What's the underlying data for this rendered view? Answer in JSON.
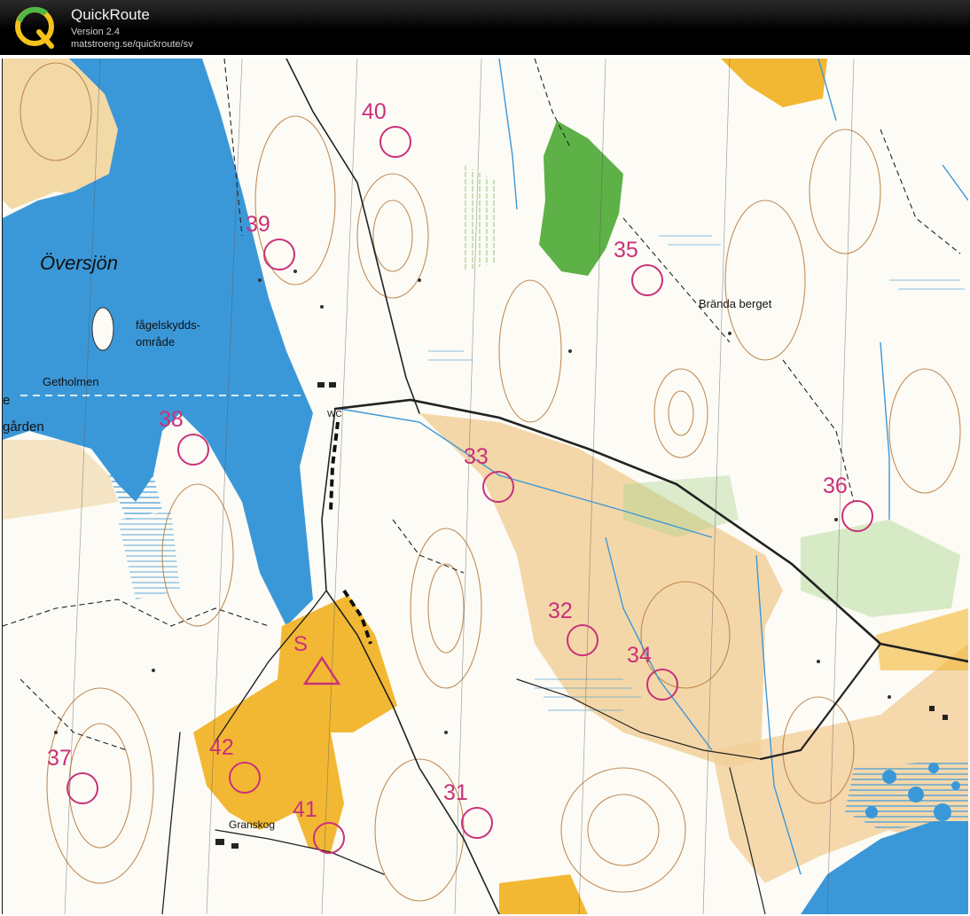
{
  "app": {
    "title": "QuickRoute",
    "version": "Version 2.4",
    "url": "matstroeng.se/quickroute/sv"
  },
  "map": {
    "place_names": {
      "lake": "Översjön",
      "bird_area_line1": "fågelskydds-",
      "bird_area_line2": "område",
      "island": "Getholmen",
      "farm_partial": "gården",
      "edge_letter": "e",
      "hill": "Brända berget",
      "village": "Granskog",
      "toilet": "WC"
    },
    "start_label": "S",
    "controls": [
      "31",
      "32",
      "33",
      "34",
      "35",
      "36",
      "37",
      "38",
      "39",
      "40",
      "41",
      "42"
    ],
    "colors": {
      "water": "#3b98d8",
      "open_land": "#f0c98a",
      "rough_open": "#f6dfb0",
      "yellow_field": "#f2b833",
      "green": "#5db146",
      "contour": "#b57a3e",
      "course": "#c8317a",
      "road": "#222222"
    }
  }
}
